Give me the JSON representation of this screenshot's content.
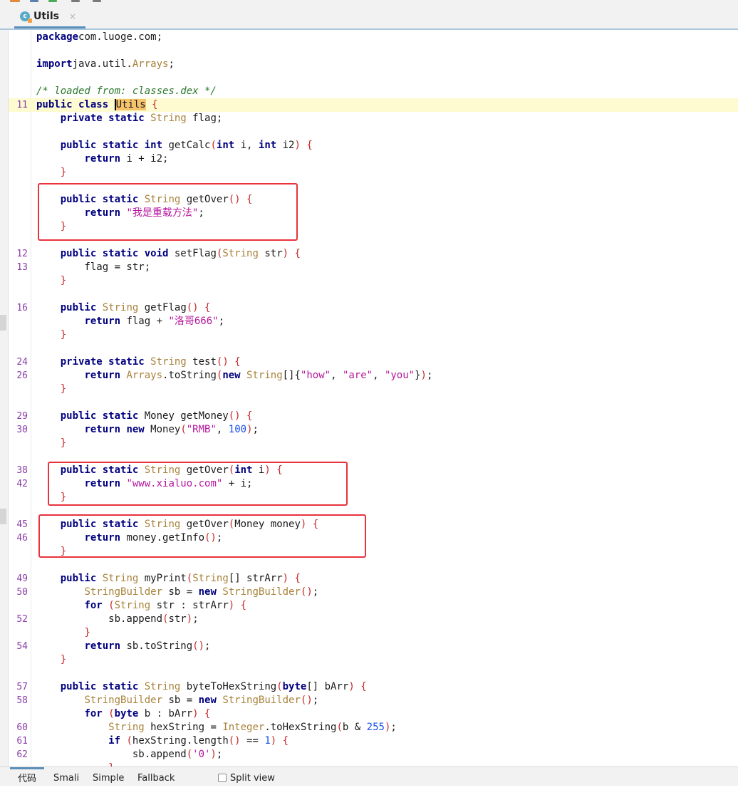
{
  "tab": {
    "label": "Utils",
    "close": "×",
    "icon": "class-icon"
  },
  "bottom_tabs": [
    "代码",
    "Smali",
    "Simple",
    "Fallback"
  ],
  "split_view": {
    "label": "Split view",
    "checked": false
  },
  "lines": [
    {
      "n": "",
      "segs": [
        [
          "kw",
          "package"
        ],
        [
          "",
          "com.luoge.com;"
        ]
      ]
    },
    {
      "n": "",
      "segs": []
    },
    {
      "n": "",
      "segs": [
        [
          "kw",
          "import"
        ],
        [
          "",
          "java.util."
        ],
        [
          "ty",
          "Arrays"
        ],
        [
          "",
          ";"
        ]
      ]
    },
    {
      "n": "",
      "segs": []
    },
    {
      "n": "",
      "segs": [
        [
          "cmt",
          "/* loaded from: classes.dex */"
        ]
      ]
    },
    {
      "n": "11",
      "current": true,
      "segs": [
        [
          "kw",
          "public class "
        ],
        [
          "hl caret",
          "U"
        ],
        [
          "hl",
          "tils"
        ],
        [
          "",
          " "
        ],
        [
          "pr",
          "{"
        ]
      ]
    },
    {
      "n": "",
      "segs": [
        [
          "",
          "    "
        ],
        [
          "kw",
          "private static "
        ],
        [
          "ty",
          "String"
        ],
        [
          "",
          " flag;"
        ]
      ]
    },
    {
      "n": "",
      "segs": []
    },
    {
      "n": "",
      "segs": [
        [
          "",
          "    "
        ],
        [
          "kw",
          "public static int "
        ],
        [
          "",
          "getCalc"
        ],
        [
          "pr",
          "("
        ],
        [
          "kw",
          "int"
        ],
        [
          "",
          " i, "
        ],
        [
          "kw",
          "int"
        ],
        [
          "",
          " i2"
        ],
        [
          "pr",
          ")"
        ],
        [
          "",
          " "
        ],
        [
          "pr",
          "{"
        ]
      ]
    },
    {
      "n": "",
      "segs": [
        [
          "",
          "        "
        ],
        [
          "kw",
          "return"
        ],
        [
          "",
          " i + i2;"
        ]
      ]
    },
    {
      "n": "",
      "segs": [
        [
          "",
          "    "
        ],
        [
          "pr",
          "}"
        ]
      ]
    },
    {
      "n": "",
      "segs": []
    },
    {
      "n": "",
      "segs": [
        [
          "",
          "    "
        ],
        [
          "kw",
          "public static "
        ],
        [
          "ty",
          "String"
        ],
        [
          "",
          " getOver"
        ],
        [
          "pr",
          "()"
        ],
        [
          "",
          " "
        ],
        [
          "pr",
          "{"
        ]
      ]
    },
    {
      "n": "",
      "segs": [
        [
          "",
          "        "
        ],
        [
          "kw",
          "return "
        ],
        [
          "str",
          "\"我是重载方法\""
        ],
        [
          "",
          ";"
        ]
      ]
    },
    {
      "n": "",
      "segs": [
        [
          "",
          "    "
        ],
        [
          "pr",
          "}"
        ]
      ]
    },
    {
      "n": "",
      "segs": []
    },
    {
      "n": "12",
      "segs": [
        [
          "",
          "    "
        ],
        [
          "kw",
          "public static void "
        ],
        [
          "",
          "setFlag"
        ],
        [
          "pr",
          "("
        ],
        [
          "ty",
          "String"
        ],
        [
          "",
          " str"
        ],
        [
          "pr",
          ")"
        ],
        [
          "",
          " "
        ],
        [
          "pr",
          "{"
        ]
      ]
    },
    {
      "n": "13",
      "segs": [
        [
          "",
          "        flag = str;"
        ]
      ]
    },
    {
      "n": "",
      "segs": [
        [
          "",
          "    "
        ],
        [
          "pr",
          "}"
        ]
      ]
    },
    {
      "n": "",
      "segs": []
    },
    {
      "n": "16",
      "segs": [
        [
          "",
          "    "
        ],
        [
          "kw",
          "public "
        ],
        [
          "ty",
          "String"
        ],
        [
          "",
          " getFlag"
        ],
        [
          "pr",
          "()"
        ],
        [
          "",
          " "
        ],
        [
          "pr",
          "{"
        ]
      ]
    },
    {
      "n": "",
      "segs": [
        [
          "",
          "        "
        ],
        [
          "kw",
          "return"
        ],
        [
          "",
          " flag + "
        ],
        [
          "str",
          "\"洛哥666\""
        ],
        [
          "",
          ";"
        ]
      ]
    },
    {
      "n": "",
      "segs": [
        [
          "",
          "    "
        ],
        [
          "pr",
          "}"
        ]
      ]
    },
    {
      "n": "",
      "segs": []
    },
    {
      "n": "24",
      "segs": [
        [
          "",
          "    "
        ],
        [
          "kw",
          "private static "
        ],
        [
          "ty",
          "String"
        ],
        [
          "",
          " test"
        ],
        [
          "pr",
          "()"
        ],
        [
          "",
          " "
        ],
        [
          "pr",
          "{"
        ]
      ]
    },
    {
      "n": "26",
      "segs": [
        [
          "",
          "        "
        ],
        [
          "kw",
          "return "
        ],
        [
          "ty",
          "Arrays"
        ],
        [
          "",
          ".toString"
        ],
        [
          "pr",
          "("
        ],
        [
          "kw",
          "new "
        ],
        [
          "ty",
          "String"
        ],
        [
          "",
          "[]{"
        ],
        [
          "str",
          "\"how\""
        ],
        [
          "",
          ", "
        ],
        [
          "str",
          "\"are\""
        ],
        [
          "",
          ", "
        ],
        [
          "str",
          "\"you\""
        ],
        [
          "",
          "}"
        ],
        [
          "pr",
          ")"
        ],
        [
          "",
          ";"
        ]
      ]
    },
    {
      "n": "",
      "segs": [
        [
          "",
          "    "
        ],
        [
          "pr",
          "}"
        ]
      ]
    },
    {
      "n": "",
      "segs": []
    },
    {
      "n": "29",
      "segs": [
        [
          "",
          "    "
        ],
        [
          "kw",
          "public static "
        ],
        [
          "",
          "Money getMoney"
        ],
        [
          "pr",
          "()"
        ],
        [
          "",
          " "
        ],
        [
          "pr",
          "{"
        ]
      ]
    },
    {
      "n": "30",
      "segs": [
        [
          "",
          "        "
        ],
        [
          "kw",
          "return new "
        ],
        [
          "",
          "Money"
        ],
        [
          "pr",
          "("
        ],
        [
          "str",
          "\"RMB\""
        ],
        [
          "",
          ", "
        ],
        [
          "num",
          "100"
        ],
        [
          "pr",
          ")"
        ],
        [
          "",
          ";"
        ]
      ]
    },
    {
      "n": "",
      "segs": [
        [
          "",
          "    "
        ],
        [
          "pr",
          "}"
        ]
      ]
    },
    {
      "n": "",
      "segs": []
    },
    {
      "n": "38",
      "segs": [
        [
          "",
          "    "
        ],
        [
          "kw",
          "public static "
        ],
        [
          "ty",
          "String"
        ],
        [
          "",
          " getOver"
        ],
        [
          "pr",
          "("
        ],
        [
          "kw",
          "int"
        ],
        [
          "",
          " i"
        ],
        [
          "pr",
          ")"
        ],
        [
          "",
          " "
        ],
        [
          "pr",
          "{"
        ]
      ]
    },
    {
      "n": "42",
      "segs": [
        [
          "",
          "        "
        ],
        [
          "kw",
          "return "
        ],
        [
          "str",
          "\"www.xialuo.com\""
        ],
        [
          "",
          " + i;"
        ]
      ]
    },
    {
      "n": "",
      "segs": [
        [
          "",
          "    "
        ],
        [
          "pr",
          "}"
        ]
      ]
    },
    {
      "n": "",
      "segs": []
    },
    {
      "n": "45",
      "segs": [
        [
          "",
          "    "
        ],
        [
          "kw",
          "public static "
        ],
        [
          "ty",
          "String"
        ],
        [
          "",
          " getOver"
        ],
        [
          "pr",
          "("
        ],
        [
          "",
          "Money money"
        ],
        [
          "pr",
          ")"
        ],
        [
          "",
          " "
        ],
        [
          "pr",
          "{"
        ]
      ]
    },
    {
      "n": "46",
      "segs": [
        [
          "",
          "        "
        ],
        [
          "kw",
          "return"
        ],
        [
          "",
          " money.getInfo"
        ],
        [
          "pr",
          "()"
        ],
        [
          "",
          ";"
        ]
      ]
    },
    {
      "n": "",
      "segs": [
        [
          "",
          "    "
        ],
        [
          "pr",
          "}"
        ]
      ]
    },
    {
      "n": "",
      "segs": []
    },
    {
      "n": "49",
      "segs": [
        [
          "",
          "    "
        ],
        [
          "kw",
          "public "
        ],
        [
          "ty",
          "String"
        ],
        [
          "",
          " myPrint"
        ],
        [
          "pr",
          "("
        ],
        [
          "ty",
          "String"
        ],
        [
          "",
          "[] strArr"
        ],
        [
          "pr",
          ")"
        ],
        [
          "",
          " "
        ],
        [
          "pr",
          "{"
        ]
      ]
    },
    {
      "n": "50",
      "segs": [
        [
          "",
          "        "
        ],
        [
          "ty",
          "StringBuilder"
        ],
        [
          "",
          " sb = "
        ],
        [
          "kw",
          "new "
        ],
        [
          "ty",
          "StringBuilder"
        ],
        [
          "pr",
          "()"
        ],
        [
          "",
          ";"
        ]
      ]
    },
    {
      "n": "",
      "segs": [
        [
          "",
          "        "
        ],
        [
          "kw",
          "for "
        ],
        [
          "pr",
          "("
        ],
        [
          "ty",
          "String"
        ],
        [
          "",
          " str : strArr"
        ],
        [
          "pr",
          ")"
        ],
        [
          "",
          " "
        ],
        [
          "pr",
          "{"
        ]
      ]
    },
    {
      "n": "52",
      "segs": [
        [
          "",
          "            sb.append"
        ],
        [
          "pr",
          "("
        ],
        [
          "",
          "str"
        ],
        [
          "pr",
          ")"
        ],
        [
          "",
          ";"
        ]
      ]
    },
    {
      "n": "",
      "segs": [
        [
          "",
          "        "
        ],
        [
          "pr",
          "}"
        ]
      ]
    },
    {
      "n": "54",
      "segs": [
        [
          "",
          "        "
        ],
        [
          "kw",
          "return"
        ],
        [
          "",
          " sb.toString"
        ],
        [
          "pr",
          "()"
        ],
        [
          "",
          ";"
        ]
      ]
    },
    {
      "n": "",
      "segs": [
        [
          "",
          "    "
        ],
        [
          "pr",
          "}"
        ]
      ]
    },
    {
      "n": "",
      "segs": []
    },
    {
      "n": "57",
      "segs": [
        [
          "",
          "    "
        ],
        [
          "kw",
          "public static "
        ],
        [
          "ty",
          "String"
        ],
        [
          "",
          " byteToHexString"
        ],
        [
          "pr",
          "("
        ],
        [
          "kw",
          "byte"
        ],
        [
          "",
          "[] bArr"
        ],
        [
          "pr",
          ")"
        ],
        [
          "",
          " "
        ],
        [
          "pr",
          "{"
        ]
      ]
    },
    {
      "n": "58",
      "segs": [
        [
          "",
          "        "
        ],
        [
          "ty",
          "StringBuilder"
        ],
        [
          "",
          " sb = "
        ],
        [
          "kw",
          "new "
        ],
        [
          "ty",
          "StringBuilder"
        ],
        [
          "pr",
          "()"
        ],
        [
          "",
          ";"
        ]
      ]
    },
    {
      "n": "",
      "segs": [
        [
          "",
          "        "
        ],
        [
          "kw",
          "for "
        ],
        [
          "pr",
          "("
        ],
        [
          "kw",
          "byte"
        ],
        [
          "",
          " b : bArr"
        ],
        [
          "pr",
          ")"
        ],
        [
          "",
          " "
        ],
        [
          "pr",
          "{"
        ]
      ]
    },
    {
      "n": "60",
      "segs": [
        [
          "",
          "            "
        ],
        [
          "ty",
          "String"
        ],
        [
          "",
          " hexString = "
        ],
        [
          "ty",
          "Integer"
        ],
        [
          "",
          ".toHexString"
        ],
        [
          "pr",
          "("
        ],
        [
          "",
          "b & "
        ],
        [
          "num",
          "255"
        ],
        [
          "pr",
          ")"
        ],
        [
          "",
          ";"
        ]
      ]
    },
    {
      "n": "61",
      "segs": [
        [
          "",
          "            "
        ],
        [
          "kw",
          "if "
        ],
        [
          "pr",
          "("
        ],
        [
          "",
          "hexString.length"
        ],
        [
          "pr",
          "()"
        ],
        [
          "",
          " == "
        ],
        [
          "num",
          "1"
        ],
        [
          "pr",
          ")"
        ],
        [
          "",
          " "
        ],
        [
          "pr",
          "{"
        ]
      ]
    },
    {
      "n": "62",
      "segs": [
        [
          "",
          "                sb.append"
        ],
        [
          "pr",
          "("
        ],
        [
          "str",
          "'0'"
        ],
        [
          "pr",
          ")"
        ],
        [
          "",
          ";"
        ]
      ]
    },
    {
      "n": "",
      "segs": [
        [
          "",
          "            "
        ],
        [
          "pr",
          "}"
        ]
      ]
    }
  ]
}
